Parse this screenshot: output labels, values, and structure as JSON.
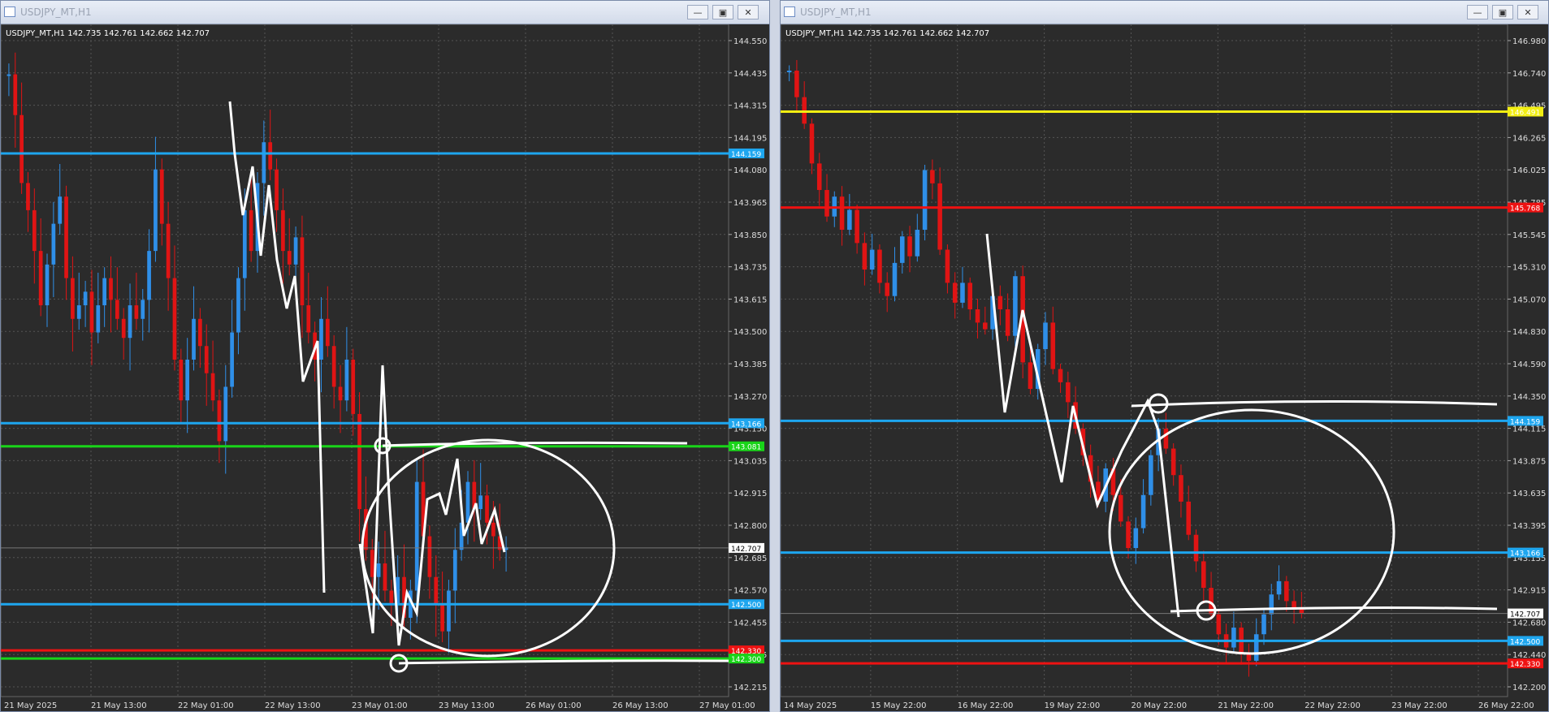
{
  "colors": {
    "bg": "#2b2b2b",
    "grid": "#555555",
    "bull": "#2f8fe8",
    "bear": "#e01414",
    "level_blue": "#1ea6ef",
    "level_green": "#19d419",
    "level_red": "#ee1212",
    "level_yellow": "#f2ee12",
    "drawing": "#ffffff",
    "axis_text": "#dddddd"
  },
  "left": {
    "window_title": "USDJPY_MT,H1",
    "info_line": "USDJPY_MT,H1  142.735 142.761 142.662 142.707",
    "price_ticks": [
      "144.550",
      "144.435",
      "144.315",
      "144.195",
      "144.080",
      "143.965",
      "143.850",
      "143.735",
      "143.615",
      "143.500",
      "143.385",
      "143.270",
      "143.150",
      "143.035",
      "142.915",
      "142.800",
      "142.685",
      "142.570",
      "142.455",
      "142.335",
      "142.215"
    ],
    "time_ticks": [
      "21 May 2025",
      "21 May 13:00",
      "22 May 01:00",
      "22 May 13:00",
      "23 May 01:00",
      "23 May 13:00",
      "26 May 01:00",
      "26 May 13:00",
      "27 May 01:00"
    ],
    "levels": [
      {
        "price": 144.159,
        "label": "144.159",
        "color": "#1ea6ef"
      },
      {
        "price": 143.166,
        "label": "143.166",
        "color": "#1ea6ef"
      },
      {
        "price": 143.081,
        "label": "143.081",
        "color": "#19d419"
      },
      {
        "price": 142.5,
        "label": "142.500",
        "color": "#1ea6ef"
      },
      {
        "price": 142.33,
        "label": "142.330",
        "color": "#ee1212"
      },
      {
        "price": 142.3,
        "label": "142.300",
        "color": "#19d419"
      }
    ],
    "current_price": "142.707",
    "chart_data": {
      "type": "candlestick",
      "symbol": "USDJPY_MT",
      "timeframe": "H1",
      "ylim": [
        142.16,
        144.61
      ],
      "series": [
        {
          "name": "close",
          "values": [
            144.45,
            144.3,
            144.05,
            143.95,
            143.8,
            143.6,
            143.75,
            143.9,
            144.0,
            143.7,
            143.55,
            143.6,
            143.65,
            143.5,
            143.6,
            143.7,
            143.62,
            143.55,
            143.48,
            143.6,
            143.55,
            143.62,
            143.8,
            144.1,
            143.9,
            143.7,
            143.4,
            143.25,
            143.4,
            143.55,
            143.45,
            143.35,
            143.25,
            143.1,
            143.3,
            143.5,
            143.7,
            143.95,
            143.8,
            144.05,
            144.2,
            144.1,
            143.95,
            143.8,
            143.75,
            143.85,
            143.6,
            143.5,
            143.4,
            143.55,
            143.45,
            143.3,
            143.25,
            143.4,
            143.2,
            142.85,
            142.7,
            142.6,
            142.65,
            142.55,
            142.5,
            142.6,
            142.45,
            142.55,
            142.95,
            142.75,
            142.6,
            142.5,
            142.4,
            142.55,
            142.7,
            142.8,
            142.95,
            142.85,
            142.9,
            142.8,
            142.75,
            142.7,
            142.71
          ]
        }
      ]
    }
  },
  "right": {
    "window_title": "USDJPY_MT,H1",
    "info_line": "USDJPY_MT,H1  142.735 142.761 142.662 142.707",
    "price_ticks": [
      "146.980",
      "146.740",
      "146.495",
      "146.265",
      "146.025",
      "145.785",
      "145.545",
      "145.310",
      "145.070",
      "144.830",
      "144.590",
      "144.350",
      "144.115",
      "143.875",
      "143.635",
      "143.395",
      "143.155",
      "142.915",
      "142.680",
      "142.440",
      "142.200"
    ],
    "time_ticks": [
      "14 May 2025",
      "15 May 22:00",
      "16 May 22:00",
      "19 May 22:00",
      "20 May 22:00",
      "21 May 22:00",
      "22 May 22:00",
      "23 May 22:00",
      "26 May 22:00"
    ],
    "levels": [
      {
        "price": 146.491,
        "label": "146.491",
        "color": "#f2ee12"
      },
      {
        "price": 145.768,
        "label": "145.768",
        "color": "#ee1212"
      },
      {
        "price": 144.159,
        "label": "144.159",
        "color": "#1ea6ef"
      },
      {
        "price": 143.166,
        "label": "143.166",
        "color": "#1ea6ef"
      },
      {
        "price": 142.5,
        "label": "142.500",
        "color": "#1ea6ef"
      },
      {
        "price": 142.33,
        "label": "142.330",
        "color": "#ee1212"
      }
    ],
    "current_price": "142.707",
    "chart_data": {
      "type": "candlestick",
      "symbol": "USDJPY_MT",
      "timeframe": "H1",
      "ylim": [
        142.08,
        147.1
      ],
      "series": [
        {
          "name": "close",
          "values": [
            146.8,
            146.6,
            146.4,
            146.1,
            145.9,
            145.7,
            145.85,
            145.6,
            145.75,
            145.5,
            145.3,
            145.45,
            145.2,
            145.1,
            145.35,
            145.55,
            145.4,
            145.6,
            146.05,
            145.95,
            145.45,
            145.2,
            145.05,
            145.2,
            145.0,
            144.9,
            144.85,
            145.1,
            145.0,
            144.8,
            145.25,
            144.6,
            144.4,
            144.7,
            144.9,
            144.55,
            144.45,
            144.3,
            144.1,
            143.9,
            143.7,
            143.55,
            143.8,
            143.6,
            143.4,
            143.2,
            143.35,
            143.6,
            143.9,
            144.1,
            143.95,
            143.75,
            143.55,
            143.3,
            143.1,
            142.9,
            142.7,
            142.55,
            142.45,
            142.6,
            142.4,
            142.35,
            142.55,
            142.7,
            142.85,
            142.95,
            142.8,
            142.75,
            142.71
          ]
        }
      ]
    }
  }
}
